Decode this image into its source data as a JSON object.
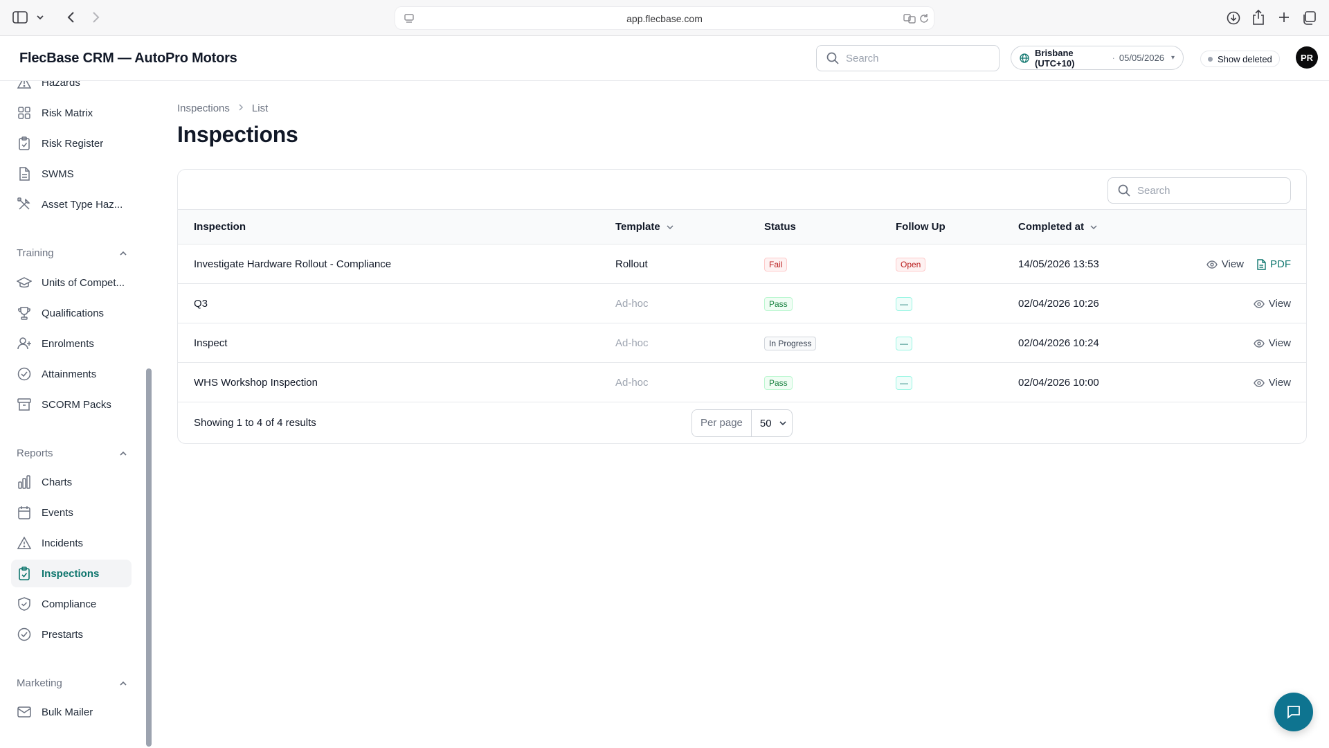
{
  "browser": {
    "url": "app.flecbase.com"
  },
  "header": {
    "app_title": "FlecBase CRM — AutoPro Motors",
    "search_placeholder": "Search",
    "timezone_city": "Brisbane (UTC+10)",
    "timezone_sep": "·",
    "timezone_date": "05/05/2026",
    "show_deleted": "Show deleted",
    "avatar_initials": "PR"
  },
  "sidebar": {
    "items_top": [
      {
        "label": "Hazards",
        "icon": "warning-icon"
      },
      {
        "label": "Risk Matrix",
        "icon": "grid-icon"
      },
      {
        "label": "Risk Register",
        "icon": "clipboard-check-icon"
      },
      {
        "label": "SWMS",
        "icon": "document-icon"
      },
      {
        "label": "Asset Type Haz...",
        "icon": "tools-icon"
      }
    ],
    "training": {
      "title": "Training",
      "items": [
        {
          "label": "Units of Compet...",
          "icon": "graduation-cap-icon"
        },
        {
          "label": "Qualifications",
          "icon": "trophy-icon"
        },
        {
          "label": "Enrolments",
          "icon": "user-plus-icon"
        },
        {
          "label": "Attainments",
          "icon": "check-circle-icon"
        },
        {
          "label": "SCORM Packs",
          "icon": "archive-icon"
        }
      ]
    },
    "reports": {
      "title": "Reports",
      "items": [
        {
          "label": "Charts",
          "icon": "bar-chart-icon"
        },
        {
          "label": "Events",
          "icon": "calendar-icon"
        },
        {
          "label": "Incidents",
          "icon": "warning-icon"
        },
        {
          "label": "Inspections",
          "icon": "clipboard-check-icon",
          "active": true
        },
        {
          "label": "Compliance",
          "icon": "shield-check-icon"
        },
        {
          "label": "Prestarts",
          "icon": "check-circle-icon"
        }
      ]
    },
    "marketing": {
      "title": "Marketing",
      "items": [
        {
          "label": "Bulk Mailer",
          "icon": "mail-icon"
        }
      ]
    }
  },
  "main": {
    "breadcrumb": [
      "Inspections",
      "List"
    ],
    "title": "Inspections",
    "table_search_placeholder": "Search",
    "columns": {
      "inspection": "Inspection",
      "template": "Template",
      "status": "Status",
      "follow_up": "Follow Up",
      "completed_at": "Completed at"
    },
    "rows": [
      {
        "inspection": "Investigate Hardware Rollout - Compliance",
        "template": "Rollout",
        "status": "Fail",
        "follow_up": "Open",
        "completed_at": "14/05/2026 13:53",
        "view": "View",
        "pdf": "PDF"
      },
      {
        "inspection": "Q3",
        "template": "Ad-hoc",
        "status": "Pass",
        "follow_up": "—",
        "completed_at": "02/04/2026 10:26",
        "view": "View"
      },
      {
        "inspection": "Inspect",
        "template": "Ad-hoc",
        "status": "In Progress",
        "follow_up": "—",
        "completed_at": "02/04/2026 10:24",
        "view": "View"
      },
      {
        "inspection": "WHS Workshop Inspection",
        "template": "Ad-hoc",
        "status": "Pass",
        "follow_up": "—",
        "completed_at": "02/04/2026 10:00",
        "view": "View"
      }
    ],
    "footer": {
      "results": "Showing 1 to 4 of 4 results",
      "per_page_label": "Per page",
      "per_page_value": "50"
    }
  },
  "colors": {
    "accent": "#0f766e",
    "chat_button": "#0e7490",
    "fail": "#b91c1c",
    "pass": "#15803d"
  }
}
